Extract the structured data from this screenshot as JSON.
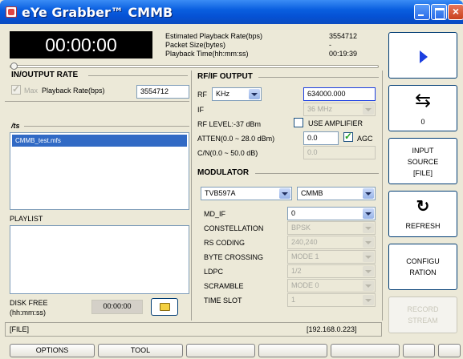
{
  "window": {
    "title": "eYe Grabber™ CMMB"
  },
  "timer": {
    "display": "00:00:00"
  },
  "info": {
    "rate_label": "Estimated Playback Rate(bps)",
    "rate_value": "3554712",
    "packet_label": "Packet Size(bytes)",
    "packet_value": "-",
    "time_label": "Playback Time(hh:mm:ss)",
    "time_value": "00:19:39"
  },
  "io_rate": {
    "title": "IN/OUTPUT RATE",
    "max_label": "Max",
    "rate_label": "Playback Rate(bps)",
    "rate_value": "3554712"
  },
  "files": {
    "title": "/ts",
    "items": [
      "CMMB_test.mfs"
    ]
  },
  "playlist": {
    "title": "PLAYLIST"
  },
  "disk": {
    "label_line1": "DISK FREE",
    "label_line2": "(hh:mm:ss)",
    "value": "00:00:00"
  },
  "rf": {
    "title": "RF/IF OUTPUT",
    "rf_label": "RF",
    "unit": "KHz",
    "rf_value": "634000.000",
    "if_label": "IF",
    "if_value": "36 MHz",
    "level_label": "RF LEVEL:-37 dBm",
    "amp_label": "USE AMPLIFIER",
    "atten_label": "ATTEN(0.0 ~ 28.0 dBm)",
    "atten_value": "0.0",
    "agc_label": "AGC",
    "cn_label": "C/N(0.0 ~ 50.0 dB)",
    "cn_value": "0.0"
  },
  "modulator": {
    "title": "MODULATOR",
    "device": "TVB597A",
    "standard": "CMMB",
    "rows": [
      {
        "label": "MD_IF",
        "value": "0"
      },
      {
        "label": "CONSTELLATION",
        "value": "BPSK"
      },
      {
        "label": "RS CODING",
        "value": "240,240"
      },
      {
        "label": "BYTE CROSSING",
        "value": "MODE 1"
      },
      {
        "label": "LDPC",
        "value": "1/2"
      },
      {
        "label": "SCRAMBLE",
        "value": "MODE 0"
      },
      {
        "label": "TIME SLOT",
        "value": "1"
      }
    ]
  },
  "buttons": {
    "loop_count": "0",
    "input_l1": "INPUT",
    "input_l2": "SOURCE",
    "input_l3": "[FILE]",
    "refresh": "REFRESH",
    "config_l1": "CONFIGU",
    "config_l2": "RATION",
    "record_l1": "RECORD",
    "record_l2": "STREAM"
  },
  "status": {
    "source": "[FILE]",
    "ip": "[192.168.0.223]"
  },
  "tabs": [
    "OPTIONS",
    "TOOL",
    "",
    "",
    "",
    "",
    ""
  ],
  "colors": {
    "title_bar": "#0551d4",
    "accent_blue": "#1c3fe0",
    "selection": "#316ac5"
  }
}
